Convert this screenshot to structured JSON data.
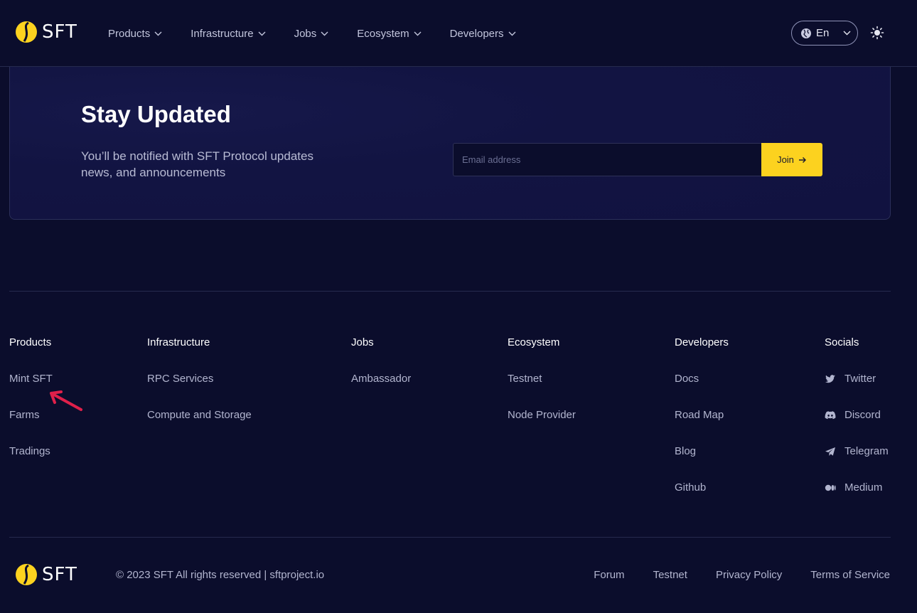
{
  "brand": {
    "name": "SFT",
    "accent": "#fcd21f",
    "background": "#0b0d2c"
  },
  "header": {
    "nav": [
      {
        "label": "Products"
      },
      {
        "label": "Infrastructure"
      },
      {
        "label": "Jobs"
      },
      {
        "label": "Ecosystem"
      },
      {
        "label": "Developers"
      }
    ],
    "language": "En",
    "theme_icon": "sun-icon"
  },
  "newsletter": {
    "title": "Stay Updated",
    "text": "You’ll be notified with SFT Protocol updates news, and announcements",
    "email_placeholder": "Email address",
    "join_label": "Join",
    "join_icon": "arrow-right-icon"
  },
  "footer": {
    "columns": [
      {
        "heading": "Products",
        "links": [
          "Mint SFT",
          "Farms",
          "Tradings"
        ]
      },
      {
        "heading": "Infrastructure",
        "links": [
          "RPC Services",
          "Compute and Storage"
        ]
      },
      {
        "heading": "Jobs",
        "links": [
          "Ambassador"
        ]
      },
      {
        "heading": "Ecosystem",
        "links": [
          "Testnet",
          "Node Provider"
        ]
      },
      {
        "heading": "Developers",
        "links": [
          "Docs",
          "Road Map",
          "Blog",
          "Github"
        ]
      },
      {
        "heading": "Socials",
        "links": [
          "Twitter",
          "Discord",
          "Telegram",
          "Medium"
        ]
      }
    ],
    "social_icons": [
      "twitter-icon",
      "discord-icon",
      "telegram-icon",
      "medium-icon"
    ],
    "copyright": "© 2023 SFT All rights reserved | sftproject.io",
    "legal_links": [
      "Forum",
      "Testnet",
      "Privacy Policy",
      "Terms of Service"
    ]
  },
  "annotation": {
    "arrow_color": "#e0204a"
  }
}
